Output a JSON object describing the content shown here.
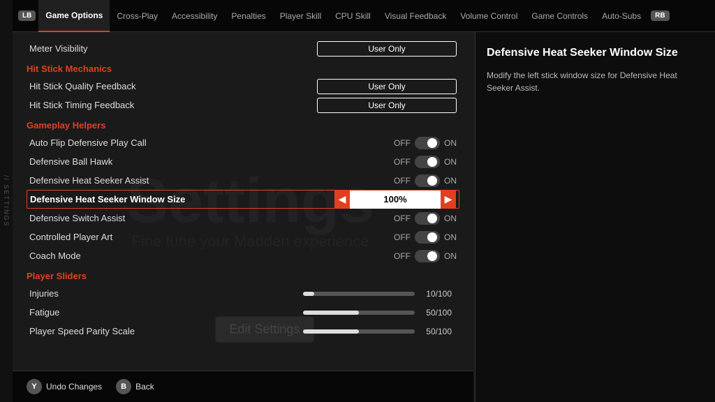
{
  "sidebar": {
    "label": "// SETTINGS"
  },
  "nav": {
    "lb": "LB",
    "rb": "RB",
    "items": [
      {
        "id": "game-options",
        "label": "Game Options",
        "active": true
      },
      {
        "id": "cross-play",
        "label": "Cross-Play",
        "active": false
      },
      {
        "id": "accessibility",
        "label": "Accessibility",
        "active": false
      },
      {
        "id": "penalties",
        "label": "Penalties",
        "active": false
      },
      {
        "id": "player-skill",
        "label": "Player Skill",
        "active": false
      },
      {
        "id": "cpu-skill",
        "label": "CPU Skill",
        "active": false
      },
      {
        "id": "visual-feedback",
        "label": "Visual Feedback",
        "active": false
      },
      {
        "id": "volume-control",
        "label": "Volume Control",
        "active": false
      },
      {
        "id": "game-controls",
        "label": "Game Controls",
        "active": false
      },
      {
        "id": "auto-subs",
        "label": "Auto-Subs",
        "active": false
      }
    ]
  },
  "content": {
    "meter_visibility_label": "Meter Visibility",
    "meter_visibility_value": "User Only",
    "hit_stick_section": "Hit Stick Mechanics",
    "hit_stick_quality_label": "Hit Stick Quality Feedback",
    "hit_stick_quality_value": "User Only",
    "hit_stick_timing_label": "Hit Stick Timing Feedback",
    "hit_stick_timing_value": "User Only",
    "gameplay_helpers_section": "Gameplay Helpers",
    "rows": [
      {
        "label": "Auto Flip Defensive Play Call",
        "type": "toggle",
        "off": "OFF",
        "on": "ON"
      },
      {
        "label": "Defensive Ball Hawk",
        "type": "toggle",
        "off": "OFF",
        "on": "ON"
      },
      {
        "label": "Defensive Heat Seeker Assist",
        "type": "toggle",
        "off": "OFF",
        "on": "ON"
      },
      {
        "label": "Defensive Heat Seeker Window Size",
        "type": "percent",
        "value": "100%",
        "highlighted": true
      },
      {
        "label": "Defensive Switch Assist",
        "type": "toggle",
        "off": "OFF",
        "on": "ON"
      },
      {
        "label": "Controlled Player Art",
        "type": "toggle",
        "off": "OFF",
        "on": "ON"
      },
      {
        "label": "Coach Mode",
        "type": "toggle",
        "off": "OFF",
        "on": "ON"
      }
    ],
    "player_sliders_section": "Player Sliders",
    "sliders": [
      {
        "label": "Injuries",
        "value": "10/100",
        "fill_pct": 10
      },
      {
        "label": "Fatigue",
        "value": "50/100",
        "fill_pct": 50
      },
      {
        "label": "Player Speed Parity Scale",
        "value": "50/100",
        "fill_pct": 50
      }
    ]
  },
  "watermark": {
    "main": "Settings",
    "sub": "Fine tune your Madden experience",
    "edit_settings": "Edit Settings"
  },
  "right_panel": {
    "title": "Defensive Heat Seeker Window Size",
    "description": "Modify the left stick window size for Defensive Heat Seeker Assist."
  },
  "bottom_bar": {
    "undo_icon": "Y",
    "undo_label": "Undo Changes",
    "back_icon": "B",
    "back_label": "Back"
  }
}
